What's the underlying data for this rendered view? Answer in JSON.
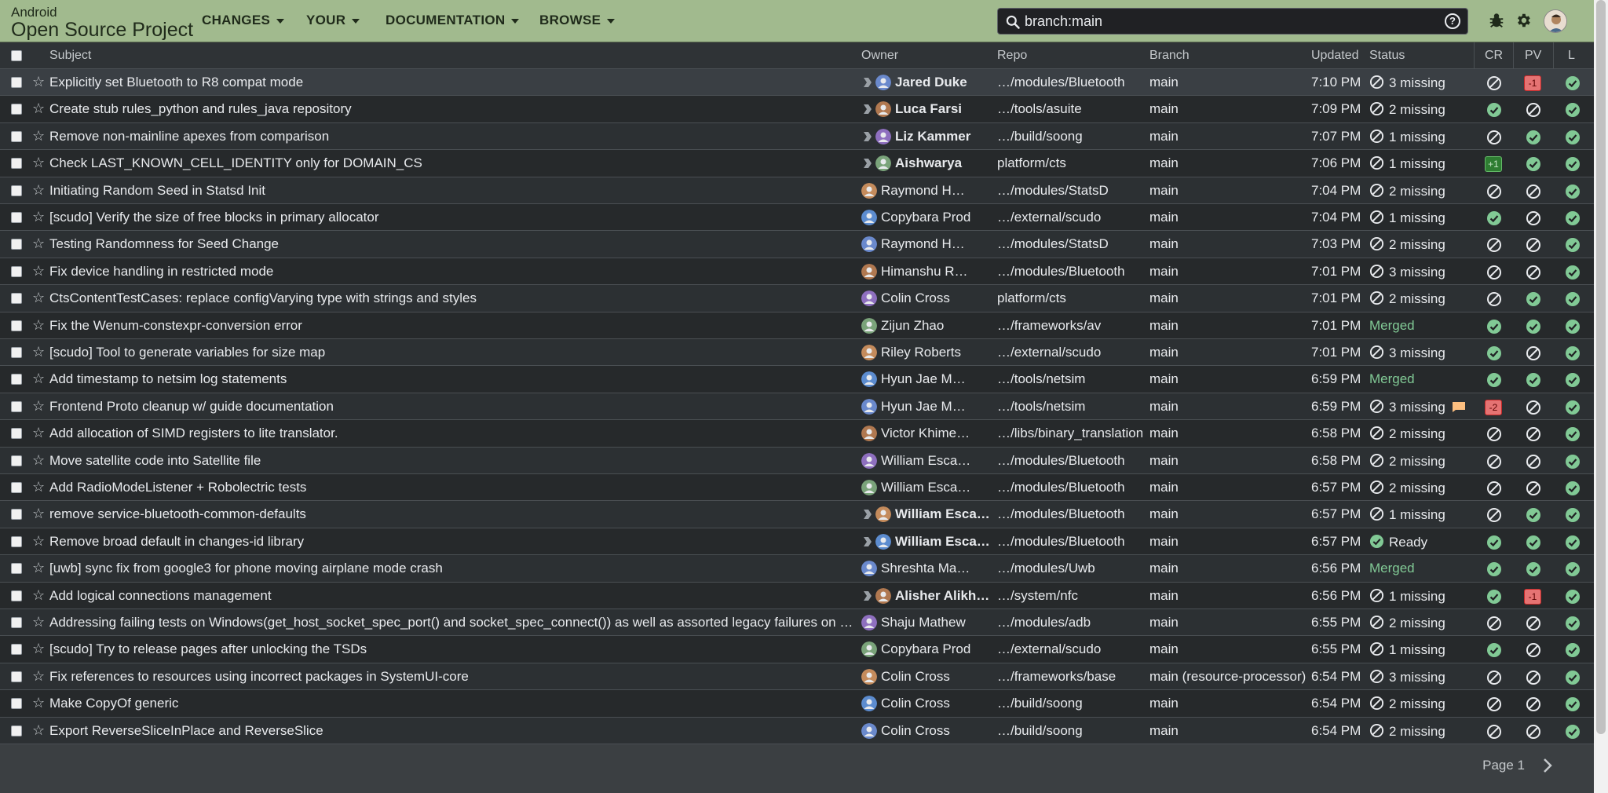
{
  "brand": {
    "line1": "Android",
    "line2": "Open Source Project"
  },
  "menus": [
    "CHANGES",
    "YOUR",
    "DOCUMENTATION",
    "BROWSE"
  ],
  "search": {
    "value": "branch:main",
    "help": "?"
  },
  "columns": {
    "subject": "Subject",
    "owner": "Owner",
    "repo": "Repo",
    "branch": "Branch",
    "updated": "Updated",
    "status": "Status",
    "cr": "CR",
    "pv": "PV",
    "l": "L"
  },
  "rows": [
    {
      "subject": "Explicitly set Bluetooth to R8 compat mode",
      "owner": "Jared Duke",
      "attn": true,
      "repo": "…/modules/Bluetooth",
      "branch": "main",
      "updated": "7:10 PM",
      "status": "3 missing",
      "cr": "na",
      "pv": "-1",
      "l": "ok"
    },
    {
      "subject": "Create stub rules_python and rules_java repository",
      "owner": "Luca Farsi",
      "attn": true,
      "repo": "…/tools/asuite",
      "branch": "main",
      "updated": "7:09 PM",
      "status": "2 missing",
      "cr": "ok",
      "pv": "na",
      "l": "ok"
    },
    {
      "subject": "Remove non-mainline apexes from comparison",
      "owner": "Liz Kammer",
      "attn": true,
      "repo": "…/build/soong",
      "branch": "main",
      "updated": "7:07 PM",
      "status": "1 missing",
      "cr": "na",
      "pv": "ok",
      "l": "ok"
    },
    {
      "subject": "Check LAST_KNOWN_CELL_IDENTITY only for DOMAIN_CS",
      "owner": "Aishwarya",
      "attn": true,
      "repo": "platform/cts",
      "branch": "main",
      "updated": "7:06 PM",
      "status": "1 missing",
      "cr": "+1",
      "pv": "ok",
      "l": "ok"
    },
    {
      "subject": "Initiating Random Seed in Statsd Init",
      "owner": "Raymond Her…",
      "attn": false,
      "repo": "…/modules/StatsD",
      "branch": "main",
      "updated": "7:04 PM",
      "status": "2 missing",
      "cr": "na",
      "pv": "na",
      "l": "ok"
    },
    {
      "subject": "[scudo] Verify the size of free blocks in primary allocator",
      "owner": "Copybara Prod",
      "attn": false,
      "repo": "…/external/scudo",
      "branch": "main",
      "updated": "7:04 PM",
      "status": "1 missing",
      "cr": "ok",
      "pv": "na",
      "l": "ok"
    },
    {
      "subject": "Testing Randomness for Seed Change",
      "owner": "Raymond Her…",
      "attn": false,
      "repo": "…/modules/StatsD",
      "branch": "main",
      "updated": "7:03 PM",
      "status": "2 missing",
      "cr": "na",
      "pv": "na",
      "l": "ok"
    },
    {
      "subject": "Fix device handling in restricted mode",
      "owner": "Himanshu Ra…",
      "attn": false,
      "repo": "…/modules/Bluetooth",
      "branch": "main",
      "updated": "7:01 PM",
      "status": "3 missing",
      "cr": "na",
      "pv": "na",
      "l": "ok"
    },
    {
      "subject": "CtsContentTestCases: replace configVarying type with strings and styles",
      "owner": "Colin Cross",
      "attn": false,
      "repo": "platform/cts",
      "branch": "main",
      "updated": "7:01 PM",
      "status": "2 missing",
      "cr": "na",
      "pv": "ok",
      "l": "ok"
    },
    {
      "subject": "Fix the Wenum-constexpr-conversion error",
      "owner": "Zijun Zhao",
      "attn": false,
      "repo": "…/frameworks/av",
      "branch": "main",
      "updated": "7:01 PM",
      "status": "Merged",
      "cr": "ok",
      "pv": "ok",
      "l": "ok"
    },
    {
      "subject": "[scudo] Tool to generate variables for size map",
      "owner": "Riley Roberts",
      "attn": false,
      "repo": "…/external/scudo",
      "branch": "main",
      "updated": "7:01 PM",
      "status": "3 missing",
      "cr": "ok",
      "pv": "na",
      "l": "ok"
    },
    {
      "subject": "Add timestamp to netsim log statements",
      "owner": "Hyun Jae Moon",
      "attn": false,
      "repo": "…/tools/netsim",
      "branch": "main",
      "updated": "6:59 PM",
      "status": "Merged",
      "cr": "ok",
      "pv": "ok",
      "l": "ok"
    },
    {
      "subject": "Frontend Proto cleanup w/ guide documentation",
      "owner": "Hyun Jae Moon",
      "attn": false,
      "repo": "…/tools/netsim",
      "branch": "main",
      "updated": "6:59 PM",
      "status": "3 missing",
      "comment": true,
      "cr": "-2",
      "pv": "na",
      "l": "ok"
    },
    {
      "subject": "Add allocation of SIMD registers to lite translator.",
      "owner": "Victor Khimen…",
      "attn": false,
      "repo": "…/libs/binary_translation",
      "branch": "main",
      "updated": "6:58 PM",
      "status": "2 missing",
      "cr": "na",
      "pv": "na",
      "l": "ok"
    },
    {
      "subject": "Move satellite code into Satellite file",
      "owner": "William Escan…",
      "attn": false,
      "repo": "…/modules/Bluetooth",
      "branch": "main",
      "updated": "6:58 PM",
      "status": "2 missing",
      "cr": "na",
      "pv": "na",
      "l": "ok"
    },
    {
      "subject": "Add RadioModeListener + Robolectric tests",
      "owner": "William Escan…",
      "attn": false,
      "repo": "…/modules/Bluetooth",
      "branch": "main",
      "updated": "6:57 PM",
      "status": "2 missing",
      "cr": "na",
      "pv": "na",
      "l": "ok"
    },
    {
      "subject": "remove service-bluetooth-common-defaults",
      "owner": "William Escan…",
      "attn": true,
      "repo": "…/modules/Bluetooth",
      "branch": "main",
      "updated": "6:57 PM",
      "status": "1 missing",
      "cr": "na",
      "pv": "ok",
      "l": "ok"
    },
    {
      "subject": "Remove broad default in changes-id library",
      "owner": "William Escan…",
      "attn": true,
      "repo": "…/modules/Bluetooth",
      "branch": "main",
      "updated": "6:57 PM",
      "status": "Ready",
      "cr": "ok",
      "pv": "ok",
      "l": "ok"
    },
    {
      "subject": "[uwb] sync fix from google3 for phone moving airplane mode crash",
      "owner": "Shreshta Manu",
      "attn": false,
      "repo": "…/modules/Uwb",
      "branch": "main",
      "updated": "6:56 PM",
      "status": "Merged",
      "cr": "ok",
      "pv": "ok",
      "l": "ok"
    },
    {
      "subject": "Add logical connections management",
      "owner": "Alisher Alikho…",
      "attn": true,
      "repo": "…/system/nfc",
      "branch": "main",
      "updated": "6:56 PM",
      "status": "1 missing",
      "cr": "ok",
      "pv": "-1",
      "l": "ok"
    },
    {
      "subject": "Addressing failing tests on Windows(get_host_socket_spec_port() and socket_spec_connect()) as well as assorted legacy failures on M…",
      "owner": "Shaju Mathew",
      "attn": false,
      "repo": "…/modules/adb",
      "branch": "main",
      "updated": "6:55 PM",
      "status": "2 missing",
      "cr": "na",
      "pv": "na",
      "l": "ok"
    },
    {
      "subject": "[scudo] Try to release pages after unlocking the TSDs",
      "owner": "Copybara Prod",
      "attn": false,
      "repo": "…/external/scudo",
      "branch": "main",
      "updated": "6:55 PM",
      "status": "1 missing",
      "cr": "ok",
      "pv": "na",
      "l": "ok"
    },
    {
      "subject": "Fix references to resources using incorrect packages in SystemUI-core",
      "owner": "Colin Cross",
      "attn": false,
      "repo": "…/frameworks/base",
      "branch": "main (resource-processor)",
      "updated": "6:54 PM",
      "status": "3 missing",
      "cr": "na",
      "pv": "na",
      "l": "ok"
    },
    {
      "subject": "Make CopyOf generic",
      "owner": "Colin Cross",
      "attn": false,
      "repo": "…/build/soong",
      "branch": "main",
      "updated": "6:54 PM",
      "status": "2 missing",
      "cr": "na",
      "pv": "na",
      "l": "ok"
    },
    {
      "subject": "Export ReverseSliceInPlace and ReverseSlice",
      "owner": "Colin Cross",
      "attn": false,
      "repo": "…/build/soong",
      "branch": "main",
      "updated": "6:54 PM",
      "status": "2 missing",
      "cr": "na",
      "pv": "na",
      "l": "ok"
    }
  ],
  "footer": {
    "page": "Page 1"
  },
  "colors": {
    "header": "#a1ba8e",
    "ok": "#81c995",
    "negative": "#e57373",
    "merged": "#81c995"
  },
  "icons": [
    "search-icon",
    "help-icon",
    "bug-icon",
    "gear-icon",
    "star-icon",
    "attention-icon",
    "not-applicable-icon",
    "check-circle-icon",
    "comment-icon",
    "chevron-right-icon"
  ]
}
